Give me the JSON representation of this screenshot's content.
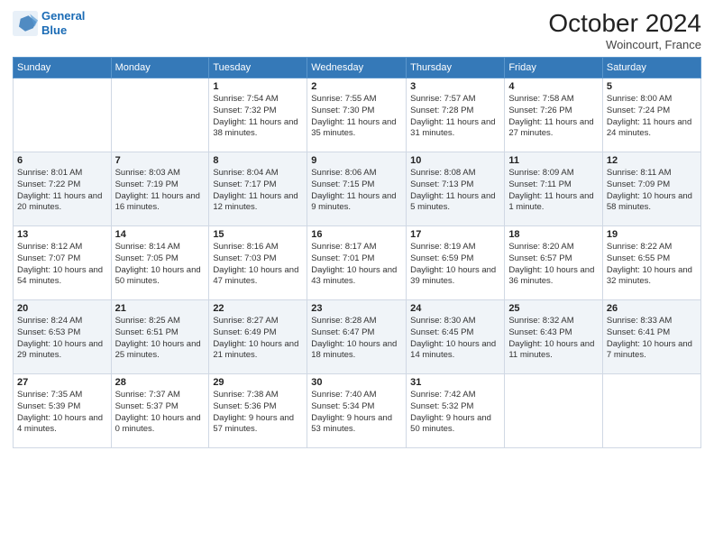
{
  "header": {
    "logo_line1": "General",
    "logo_line2": "Blue",
    "month_year": "October 2024",
    "location": "Woincourt, France"
  },
  "days_of_week": [
    "Sunday",
    "Monday",
    "Tuesday",
    "Wednesday",
    "Thursday",
    "Friday",
    "Saturday"
  ],
  "weeks": [
    [
      {
        "day": "",
        "sunrise": "",
        "sunset": "",
        "daylight": ""
      },
      {
        "day": "",
        "sunrise": "",
        "sunset": "",
        "daylight": ""
      },
      {
        "day": "1",
        "sunrise": "Sunrise: 7:54 AM",
        "sunset": "Sunset: 7:32 PM",
        "daylight": "Daylight: 11 hours and 38 minutes."
      },
      {
        "day": "2",
        "sunrise": "Sunrise: 7:55 AM",
        "sunset": "Sunset: 7:30 PM",
        "daylight": "Daylight: 11 hours and 35 minutes."
      },
      {
        "day": "3",
        "sunrise": "Sunrise: 7:57 AM",
        "sunset": "Sunset: 7:28 PM",
        "daylight": "Daylight: 11 hours and 31 minutes."
      },
      {
        "day": "4",
        "sunrise": "Sunrise: 7:58 AM",
        "sunset": "Sunset: 7:26 PM",
        "daylight": "Daylight: 11 hours and 27 minutes."
      },
      {
        "day": "5",
        "sunrise": "Sunrise: 8:00 AM",
        "sunset": "Sunset: 7:24 PM",
        "daylight": "Daylight: 11 hours and 24 minutes."
      }
    ],
    [
      {
        "day": "6",
        "sunrise": "Sunrise: 8:01 AM",
        "sunset": "Sunset: 7:22 PM",
        "daylight": "Daylight: 11 hours and 20 minutes."
      },
      {
        "day": "7",
        "sunrise": "Sunrise: 8:03 AM",
        "sunset": "Sunset: 7:19 PM",
        "daylight": "Daylight: 11 hours and 16 minutes."
      },
      {
        "day": "8",
        "sunrise": "Sunrise: 8:04 AM",
        "sunset": "Sunset: 7:17 PM",
        "daylight": "Daylight: 11 hours and 12 minutes."
      },
      {
        "day": "9",
        "sunrise": "Sunrise: 8:06 AM",
        "sunset": "Sunset: 7:15 PM",
        "daylight": "Daylight: 11 hours and 9 minutes."
      },
      {
        "day": "10",
        "sunrise": "Sunrise: 8:08 AM",
        "sunset": "Sunset: 7:13 PM",
        "daylight": "Daylight: 11 hours and 5 minutes."
      },
      {
        "day": "11",
        "sunrise": "Sunrise: 8:09 AM",
        "sunset": "Sunset: 7:11 PM",
        "daylight": "Daylight: 11 hours and 1 minute."
      },
      {
        "day": "12",
        "sunrise": "Sunrise: 8:11 AM",
        "sunset": "Sunset: 7:09 PM",
        "daylight": "Daylight: 10 hours and 58 minutes."
      }
    ],
    [
      {
        "day": "13",
        "sunrise": "Sunrise: 8:12 AM",
        "sunset": "Sunset: 7:07 PM",
        "daylight": "Daylight: 10 hours and 54 minutes."
      },
      {
        "day": "14",
        "sunrise": "Sunrise: 8:14 AM",
        "sunset": "Sunset: 7:05 PM",
        "daylight": "Daylight: 10 hours and 50 minutes."
      },
      {
        "day": "15",
        "sunrise": "Sunrise: 8:16 AM",
        "sunset": "Sunset: 7:03 PM",
        "daylight": "Daylight: 10 hours and 47 minutes."
      },
      {
        "day": "16",
        "sunrise": "Sunrise: 8:17 AM",
        "sunset": "Sunset: 7:01 PM",
        "daylight": "Daylight: 10 hours and 43 minutes."
      },
      {
        "day": "17",
        "sunrise": "Sunrise: 8:19 AM",
        "sunset": "Sunset: 6:59 PM",
        "daylight": "Daylight: 10 hours and 39 minutes."
      },
      {
        "day": "18",
        "sunrise": "Sunrise: 8:20 AM",
        "sunset": "Sunset: 6:57 PM",
        "daylight": "Daylight: 10 hours and 36 minutes."
      },
      {
        "day": "19",
        "sunrise": "Sunrise: 8:22 AM",
        "sunset": "Sunset: 6:55 PM",
        "daylight": "Daylight: 10 hours and 32 minutes."
      }
    ],
    [
      {
        "day": "20",
        "sunrise": "Sunrise: 8:24 AM",
        "sunset": "Sunset: 6:53 PM",
        "daylight": "Daylight: 10 hours and 29 minutes."
      },
      {
        "day": "21",
        "sunrise": "Sunrise: 8:25 AM",
        "sunset": "Sunset: 6:51 PM",
        "daylight": "Daylight: 10 hours and 25 minutes."
      },
      {
        "day": "22",
        "sunrise": "Sunrise: 8:27 AM",
        "sunset": "Sunset: 6:49 PM",
        "daylight": "Daylight: 10 hours and 21 minutes."
      },
      {
        "day": "23",
        "sunrise": "Sunrise: 8:28 AM",
        "sunset": "Sunset: 6:47 PM",
        "daylight": "Daylight: 10 hours and 18 minutes."
      },
      {
        "day": "24",
        "sunrise": "Sunrise: 8:30 AM",
        "sunset": "Sunset: 6:45 PM",
        "daylight": "Daylight: 10 hours and 14 minutes."
      },
      {
        "day": "25",
        "sunrise": "Sunrise: 8:32 AM",
        "sunset": "Sunset: 6:43 PM",
        "daylight": "Daylight: 10 hours and 11 minutes."
      },
      {
        "day": "26",
        "sunrise": "Sunrise: 8:33 AM",
        "sunset": "Sunset: 6:41 PM",
        "daylight": "Daylight: 10 hours and 7 minutes."
      }
    ],
    [
      {
        "day": "27",
        "sunrise": "Sunrise: 7:35 AM",
        "sunset": "Sunset: 5:39 PM",
        "daylight": "Daylight: 10 hours and 4 minutes."
      },
      {
        "day": "28",
        "sunrise": "Sunrise: 7:37 AM",
        "sunset": "Sunset: 5:37 PM",
        "daylight": "Daylight: 10 hours and 0 minutes."
      },
      {
        "day": "29",
        "sunrise": "Sunrise: 7:38 AM",
        "sunset": "Sunset: 5:36 PM",
        "daylight": "Daylight: 9 hours and 57 minutes."
      },
      {
        "day": "30",
        "sunrise": "Sunrise: 7:40 AM",
        "sunset": "Sunset: 5:34 PM",
        "daylight": "Daylight: 9 hours and 53 minutes."
      },
      {
        "day": "31",
        "sunrise": "Sunrise: 7:42 AM",
        "sunset": "Sunset: 5:32 PM",
        "daylight": "Daylight: 9 hours and 50 minutes."
      },
      {
        "day": "",
        "sunrise": "",
        "sunset": "",
        "daylight": ""
      },
      {
        "day": "",
        "sunrise": "",
        "sunset": "",
        "daylight": ""
      }
    ]
  ]
}
